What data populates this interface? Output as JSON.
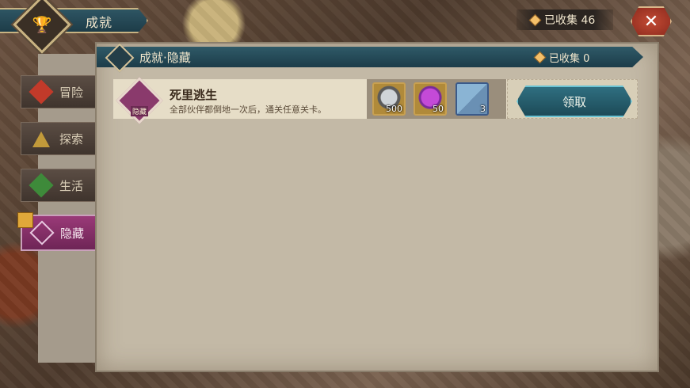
{
  "header": {
    "title": "成就",
    "collected": "已收集 46"
  },
  "sidebar": {
    "items": [
      {
        "label": "冒险"
      },
      {
        "label": "探索"
      },
      {
        "label": "生活"
      },
      {
        "label": "隐藏"
      }
    ]
  },
  "panel": {
    "title": "成就·隐藏",
    "collected": "已收集 0"
  },
  "achievement": {
    "badge": "隐藏",
    "name": "死里逃生",
    "description": "全部伙伴都倒地一次后，通关任意关卡。",
    "rewards": [
      {
        "icon": "silver-coin-icon",
        "qty": "500"
      },
      {
        "icon": "purple-gem-icon",
        "qty": "50"
      },
      {
        "icon": "scroll-icon",
        "qty": "3"
      }
    ],
    "claim_label": "领取"
  },
  "colors": {
    "accent": "#1d4b58",
    "active_tab": "#9a3a78"
  }
}
